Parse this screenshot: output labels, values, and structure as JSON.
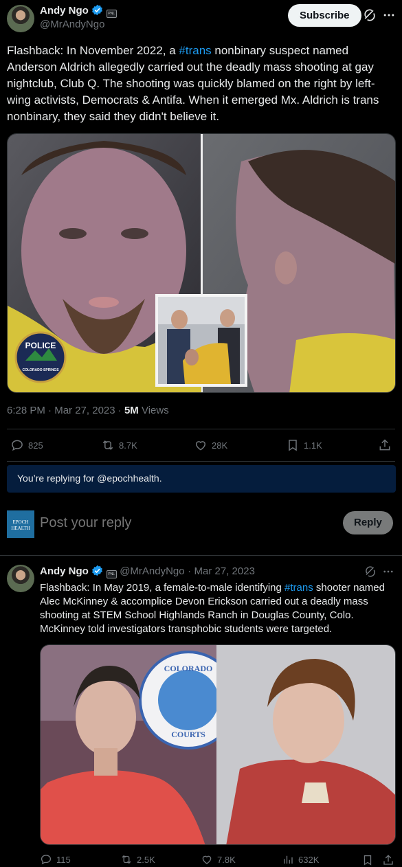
{
  "main_tweet": {
    "author_name": "Andy Ngo",
    "author_handle": "@MrAndyNgo",
    "affiliate_badge": "PNL",
    "subscribe_label": "Subscribe",
    "text_before": "Flashback: In November 2022, a ",
    "hashtag": "#trans",
    "text_after": " nonbinary suspect named Anderson Aldrich allegedly carried out the deadly mass shooting at gay nightclub, Club Q. The shooting was quickly blamed on the right by left-wing activists, Democrats & Antifa. When it emerged Mx. Aldrich is trans nonbinary, they said they didn't believe it.",
    "image_badge_word": "POLICE",
    "image_badge_sub": "COLORADO SPRINGS",
    "time": "6:28 PM",
    "date": "Mar 27, 2023",
    "views_count": "5M",
    "views_label": "Views",
    "replies": "825",
    "reposts": "8.7K",
    "likes": "28K",
    "bookmarks": "1.1K"
  },
  "reply_box": {
    "replying_notice": "You’re replying for @epochhealth.",
    "account_logo_text": "EPOCH HEALTH",
    "placeholder": "Post your reply",
    "reply_label": "Reply"
  },
  "second_tweet": {
    "author_name": "Andy Ngo",
    "author_handle": "@MrAndyNgo",
    "affiliate_badge": "PNL",
    "separator": "·",
    "date": "Mar 27, 2023",
    "text_before": "Flashback: In May 2019, a female-to-male identifying ",
    "hashtag": "#trans",
    "text_after": " shooter named Alec McKinney & accomplice Devon Erickson carried out a deadly mass shooting at STEM School Highlands Ranch in Douglas County, Colo. McKinney told investigators transphobic students were targeted.",
    "image_seal_top": "COLORADO",
    "image_seal_bottom": "COURTS",
    "replies": "115",
    "reposts": "2.5K",
    "likes": "7.8K",
    "views": "632K"
  },
  "colors": {
    "accent": "#1d9bf0",
    "background": "#000000",
    "muted": "#71767b"
  }
}
